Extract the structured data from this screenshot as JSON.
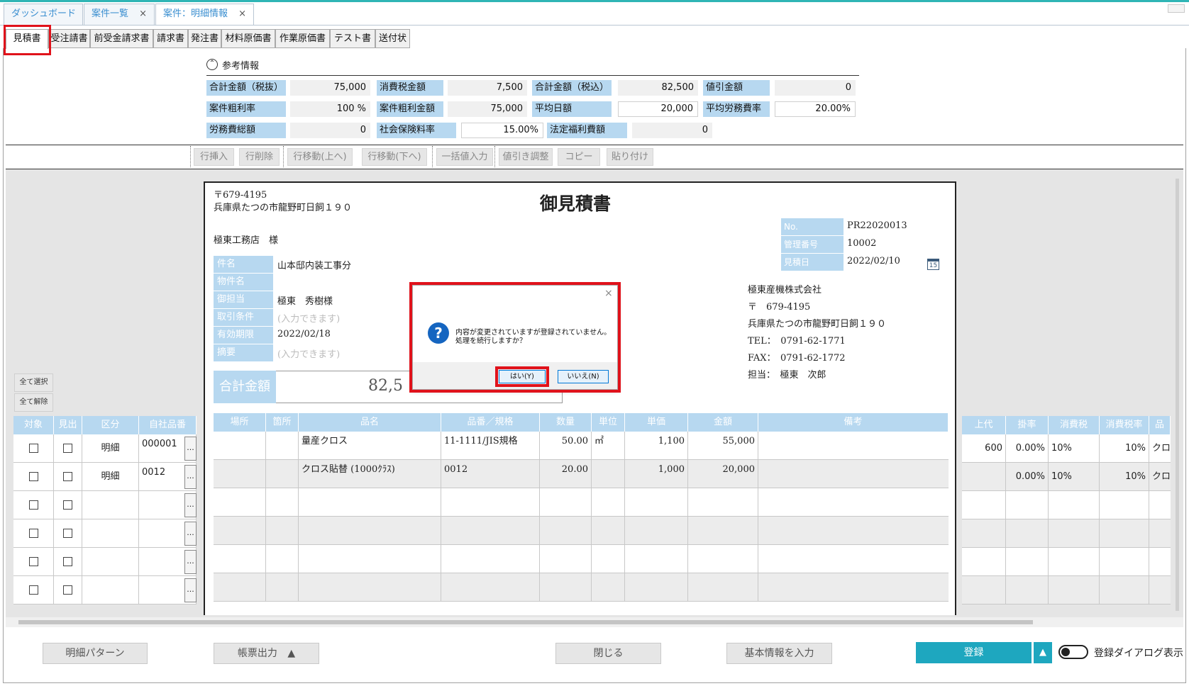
{
  "window_tabs": [
    {
      "label": "ダッシュボード",
      "closable": false
    },
    {
      "label": "案件一覧",
      "closable": true
    },
    {
      "label": "案件：明細情報",
      "closable": true
    }
  ],
  "close_glyph": "×",
  "doc_tabs": [
    "見積書",
    "受注請書",
    "前受金請求書",
    "請求書",
    "発注書",
    "材料原価書",
    "作業原価書",
    "テスト書",
    "送付状"
  ],
  "ref": {
    "toggle_glyph": "⌃",
    "title": "参考情報",
    "rows": [
      [
        {
          "label": "合計金額（税抜）",
          "value": "75,000"
        },
        {
          "label": "消費税金額",
          "value": "7,500"
        },
        {
          "label": "合計金額（税込）",
          "value": "82,500"
        },
        {
          "label": "値引金額",
          "value": "0"
        }
      ],
      [
        {
          "label": "案件粗利率",
          "value": "100 %"
        },
        {
          "label": "案件粗利金額",
          "value": "75,000"
        },
        {
          "label": "平均日額",
          "value": "20,000"
        },
        {
          "label": "平均労務費率",
          "value": "20.00%"
        }
      ],
      [
        {
          "label": "労務費総額",
          "value": "0"
        },
        {
          "label": "社会保険料率",
          "value": "15.00%"
        },
        {
          "label": "法定福利費額",
          "value": "0"
        }
      ]
    ]
  },
  "toolbar": [
    "行挿入",
    "行削除",
    "行移動(上へ)",
    "行移動(下へ)",
    "一括値入力",
    "値引き調整",
    "コピー",
    "貼り付け"
  ],
  "paper": {
    "postal": "〒679-4195",
    "address": "兵庫県たつの市龍野町日飼１９０",
    "title": "御見積書",
    "customer": "極東工務店　様",
    "fields": [
      {
        "label": "件名",
        "value": "山本邸内装工事分",
        "placeholder": false
      },
      {
        "label": "物件名",
        "value": "",
        "placeholder": false
      },
      {
        "label": "御担当",
        "value": "極東　秀樹様",
        "placeholder": false
      },
      {
        "label": "取引条件",
        "value": "(入力できます)",
        "placeholder": true
      },
      {
        "label": "有効期限",
        "value": "2022/02/18",
        "placeholder": false
      },
      {
        "label": "摘要",
        "value": "(入力できます)",
        "placeholder": true
      }
    ],
    "meta": [
      {
        "label": "No.",
        "value": "PR22020013"
      },
      {
        "label": "管理番号",
        "value": "10002"
      },
      {
        "label": "見積日",
        "value": "2022/02/10"
      }
    ],
    "calendar_day": "15",
    "company": {
      "name": "極東産機株式会社",
      "postal": "〒　679-4195",
      "address": "兵庫県たつの市龍野町日飼１９０",
      "tel": "TEL：　0791-62-1771",
      "fax": "FAX：　0791-62-1772",
      "contact": "担当：　極東　次郎"
    },
    "total_label": "合計金額",
    "total_value": "82,5",
    "table_headers": [
      "場所",
      "箇所",
      "品名",
      "品番／規格",
      "数量",
      "単位",
      "単価",
      "金額",
      "備考"
    ],
    "rows": [
      {
        "place": "",
        "spot": "",
        "name": "量産クロス",
        "code": "11-1111/JIS規格",
        "qty": "50.00",
        "unit": "㎡",
        "price": "1,100",
        "amount": "55,000",
        "note": ""
      },
      {
        "place": "",
        "spot": "",
        "name": "クロス貼替 (1000ｸﾗｽ)",
        "code": "0012",
        "qty": "20.00",
        "unit": "",
        "price": "1,000",
        "amount": "20,000",
        "note": ""
      }
    ]
  },
  "left_grid": {
    "select_all": "全て選択",
    "deselect_all": "全て解除",
    "headers": [
      "対象",
      "見出",
      "区分",
      "自社品番"
    ],
    "rows": [
      {
        "kubun": "明細",
        "code": "000001"
      },
      {
        "kubun": "明細",
        "code": "0012"
      }
    ],
    "ellipsis": "..."
  },
  "right_grid": {
    "headers": [
      "上代",
      "掛率",
      "消費税",
      "消費税率",
      "品"
    ],
    "rows": [
      {
        "jodai": "600",
        "rate": "0.00%",
        "tax": "10%",
        "taxrate": "10%",
        "item": "クロ"
      },
      {
        "jodai": "",
        "rate": "0.00%",
        "tax": "10%",
        "taxrate": "10%",
        "item": "クロ"
      }
    ]
  },
  "bottom": {
    "pattern": "明細パターン",
    "print": "帳票出力",
    "print_arrow": "▲",
    "close": "閉じる",
    "basic_info": "基本情報を入力",
    "register": "登録",
    "register_arrow": "▲",
    "toggle_label": "登録ダイアログ表示"
  },
  "dialog": {
    "close_glyph": "×",
    "icon": "?",
    "message_line1": "内容が変更されていますが登録されていません。",
    "message_line2": "処理を続行しますか？",
    "yes": "はい(Y)",
    "no": "いいえ(N)"
  },
  "colors": {
    "accent": "#2fb5b5",
    "header_blue": "#b7d8f0",
    "register": "#1ea7bf",
    "highlight_red": "#e0121b",
    "question_icon": "#1565c0"
  }
}
